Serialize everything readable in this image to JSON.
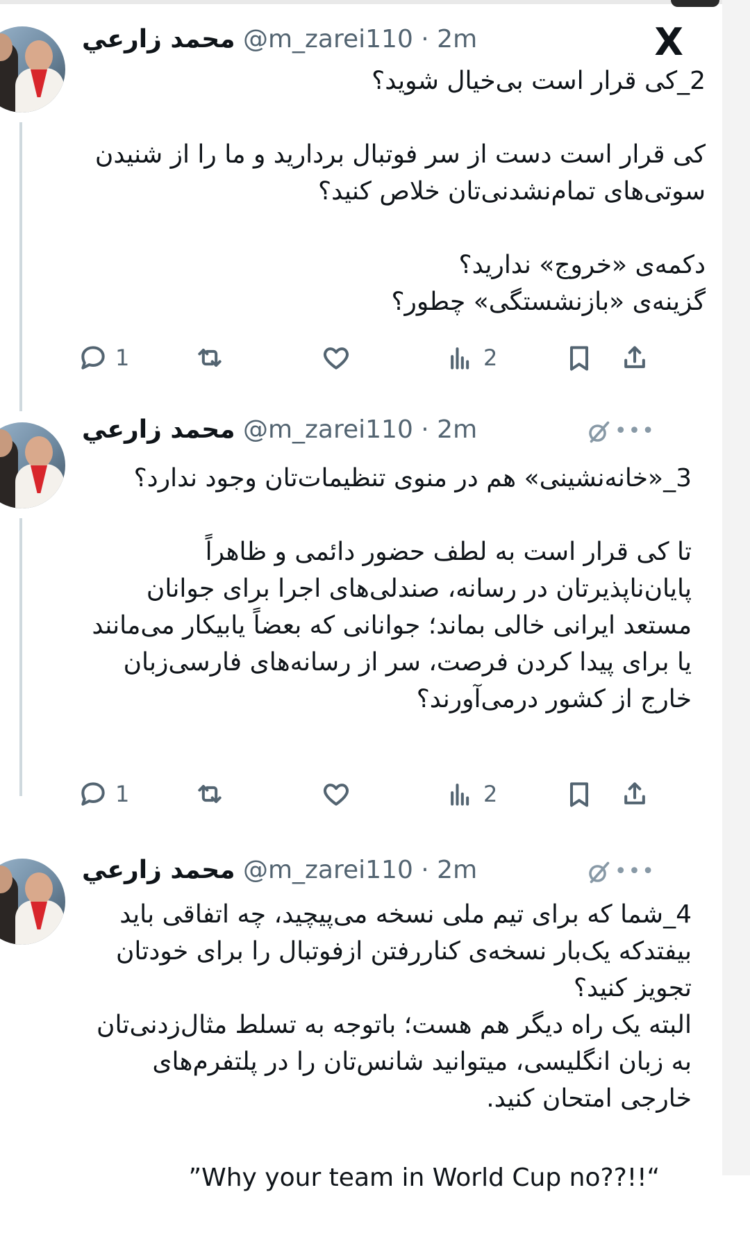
{
  "app": {
    "logo": "x-logo",
    "logo_text": "X"
  },
  "tweets": [
    {
      "name": "محمد زارعي",
      "handle": "@m_zarei110 · 2m",
      "text": "2_کی قرار است بی‌خیال شوید؟\n\nکی قرار است دست از سر فوتبال بردارید و ما را از شنیدن سوتی‌های تمام‌نشدنی‌تان خلاص کنید؟\n\nدکمه‌ی «خروج» ندارید؟\nگزینه‌ی «بازنشستگی» چطور؟",
      "actions": {
        "replies": "1",
        "reposts": "",
        "likes": "",
        "views": "2"
      }
    },
    {
      "name": "محمد زارعي",
      "handle": "@m_zarei110 · 2m",
      "text": "3_«خانه‌نشینی» هم در منوی تنظیمات‌تان وجود ندارد؟\n\nتا کی قرار است به لطف حضور دائمی و ظاهراً پایان‌ناپذیرتان در رسانه، صندلی‌های اجرا برای جوانان مستعد ایرانی خالی بماند؛ جوانانی که بعضاً یابیکار می‌مانند یا برای پیدا کردن فرصت، سر از رسانه‌های فارسی‌زبان خارج از کشور درمی‌آورند؟",
      "actions": {
        "replies": "1",
        "reposts": "",
        "likes": "",
        "views": "2"
      }
    },
    {
      "name": "محمد زارعي",
      "handle": "@m_zarei110 · 2m",
      "text": "4_شما که برای تیم ملی نسخه می‌پیچید، چه اتفاقی باید بیفتدکه یک‌بار نسخه‌ی کناررفتن ازفوتبال را برای خودتان تجویز کنید؟\nالبته یک راه دیگر هم هست؛ باتوجه به تسلط مثال‌زدنی‌تان به زبان انگلیسی، میتوانید شانس‌تان را در پلتفرم‌های خارجی امتحان کنید.",
      "quote_en": "”Why your team in World Cup no??!!“"
    }
  ],
  "icons": {
    "reply": "reply-icon",
    "repost": "repost-icon",
    "like": "heart-icon",
    "views": "views-icon",
    "bookmark": "bookmark-icon",
    "share": "share-icon",
    "grok": "grok-icon",
    "more": "more-icon"
  },
  "colors": {
    "text": "#0f1419",
    "secondary": "#536471",
    "thread_line": "#cfd9de"
  }
}
